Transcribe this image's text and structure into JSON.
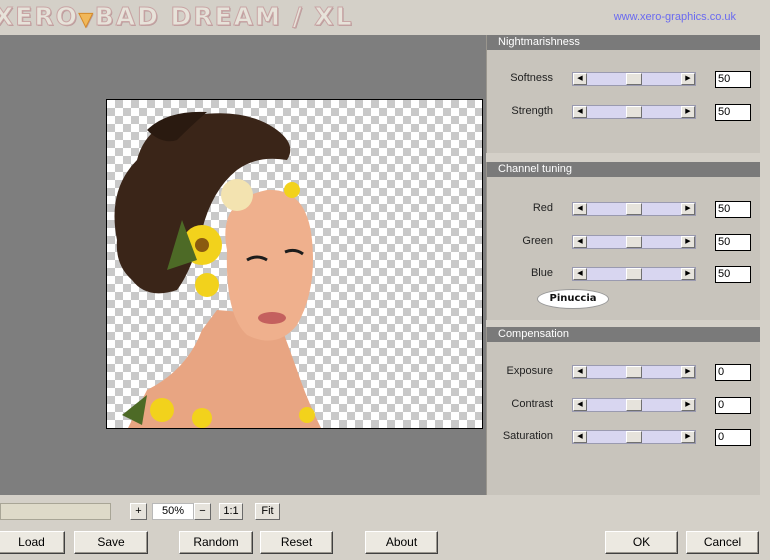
{
  "header": {
    "logo_text_a": "XERO",
    "logo_text_b": "BAD DREAM / XL",
    "site_link": "www.xero-graphics.co.uk"
  },
  "panels": {
    "nightmarishness": {
      "title": "Nightmarishness",
      "sliders": [
        {
          "label": "Softness",
          "value": "50",
          "level": 50
        },
        {
          "label": "Strength",
          "value": "50",
          "level": 50
        }
      ]
    },
    "channel_tuning": {
      "title": "Channel tuning",
      "sliders": [
        {
          "label": "Red",
          "value": "50",
          "level": 50
        },
        {
          "label": "Green",
          "value": "50",
          "level": 50
        },
        {
          "label": "Blue",
          "value": "50",
          "level": 50
        }
      ],
      "badge": "Pinuccia"
    },
    "compensation": {
      "title": "Compensation",
      "sliders": [
        {
          "label": "Exposure",
          "value": "0",
          "level": 50
        },
        {
          "label": "Contrast",
          "value": "0",
          "level": 50
        },
        {
          "label": "Saturation",
          "value": "0",
          "level": 50
        }
      ]
    }
  },
  "zoom": {
    "plus": "+",
    "value": "50%",
    "minus": "−",
    "one_to_one": "1:1",
    "fit": "Fit"
  },
  "buttons": {
    "load": "Load",
    "save": "Save",
    "random": "Random",
    "reset": "Reset",
    "about": "About",
    "ok": "OK",
    "cancel": "Cancel"
  },
  "icons": {
    "slider_left": "arrow-left-icon",
    "slider_right": "arrow-right-icon"
  }
}
